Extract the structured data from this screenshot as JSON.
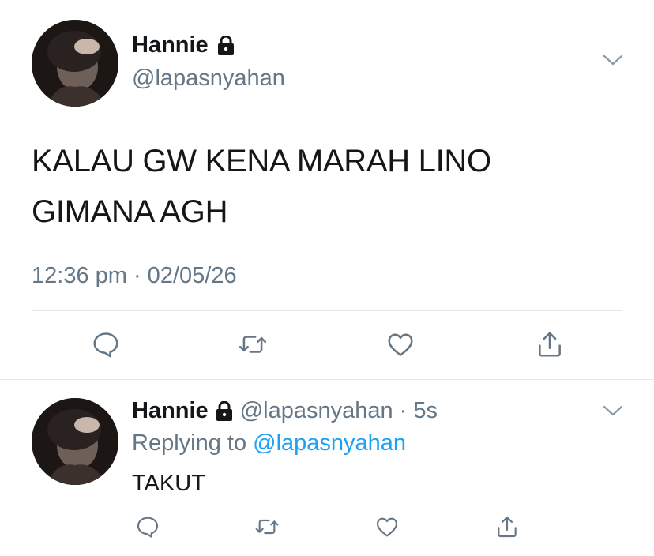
{
  "main_tweet": {
    "display_name": "Hannie",
    "handle": "@lapasnyahan",
    "text": "KALAU GW KENA MARAH LINO GIMANA AGH",
    "timestamp": "12:36 pm · 02/05/26",
    "icons": {
      "lock": "lock-icon",
      "more": "chevron-down-icon",
      "reply": "comment-icon",
      "retweet": "retweet-icon",
      "like": "heart-icon",
      "share": "share-icon"
    }
  },
  "reply_tweet": {
    "display_name": "Hannie",
    "handle_time": "@lapasnyahan · 5s",
    "replying_prefix": "Replying to",
    "replying_mention": "@lapasnyahan",
    "text": "TAKUT"
  },
  "colors": {
    "text": "#14171a",
    "secondary": "#657786",
    "link": "#1da1f2",
    "divider": "#e1e8ed"
  }
}
